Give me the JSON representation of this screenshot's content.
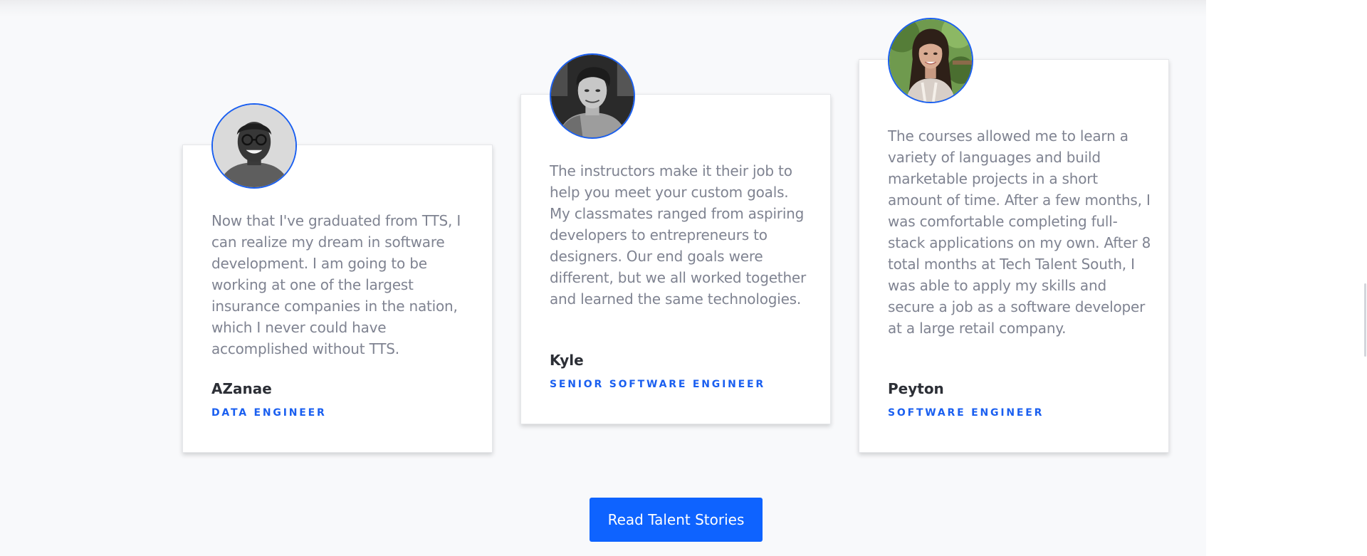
{
  "testimonials": [
    {
      "quote": "Now that I've graduated from TTS, I can realize my dream in software development. I am going to be working at one of the largest insurance companies in the nation, which I never could have accomplished without TTS.",
      "name": "AZanae",
      "role": "DATA ENGINEER"
    },
    {
      "quote": "The instructors make it their job to help you meet your custom goals. My classmates ranged from aspiring developers to entrepreneurs to designers. Our end goals were different, but we all worked together and learned the same technologies.",
      "name": "Kyle",
      "role": "SENIOR SOFTWARE ENGINEER"
    },
    {
      "quote": "The courses allowed me to learn a variety of languages and build marketable projects in a short amount of time. After a few months, I was comfortable completing full-stack applications on my own. After 8 total months at Tech Talent South, I was able to apply my skills and secure a job as a software developer at a large retail company.",
      "name": "Peyton",
      "role": "SOFTWARE ENGINEER"
    }
  ],
  "cta": {
    "label": "Read Talent Stories"
  },
  "colors": {
    "accent": "#0e63ff",
    "avatar_border": "#1a5ff0",
    "quote_text": "#7f8391",
    "name_text": "#2c2f36",
    "page_background": "#f8f9fb"
  }
}
